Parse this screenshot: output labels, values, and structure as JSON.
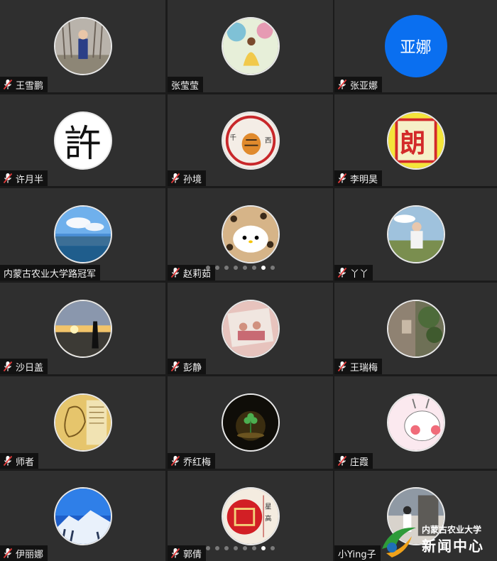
{
  "participants": [
    {
      "name": "王雪鹏",
      "muted": true
    },
    {
      "name": "张莹莹",
      "muted": false
    },
    {
      "name": "张亚娜",
      "muted": true,
      "avatar_text": "亚娜"
    },
    {
      "name": "许月半",
      "muted": true,
      "avatar_text": "許"
    },
    {
      "name": "孙境",
      "muted": true
    },
    {
      "name": "李明昊",
      "muted": true
    },
    {
      "name": "内蒙古农业大学路冠军",
      "muted": false
    },
    {
      "name": "赵莉茹",
      "muted": true
    },
    {
      "name": "丫丫",
      "muted": true
    },
    {
      "name": "沙日盖",
      "muted": true
    },
    {
      "name": "彭静",
      "muted": true
    },
    {
      "name": "王瑞梅",
      "muted": true
    },
    {
      "name": "师者",
      "muted": true
    },
    {
      "name": "乔红梅",
      "muted": true
    },
    {
      "name": "庄霞",
      "muted": true
    },
    {
      "name": "伊丽娜",
      "muted": true
    },
    {
      "name": "郭倩",
      "muted": true
    },
    {
      "name": "小Ying子",
      "muted": false
    }
  ],
  "pagination": {
    "total_pages": 8,
    "current_page": 7
  },
  "watermark": {
    "line1": "内蒙古农业大学",
    "line2": "新闻中心"
  },
  "colors": {
    "tile_bg": "#2f2f2f",
    "label_bg": "#121212",
    "mic_red": "#e23b3b",
    "avatar_blue": "#0a6ff0"
  }
}
